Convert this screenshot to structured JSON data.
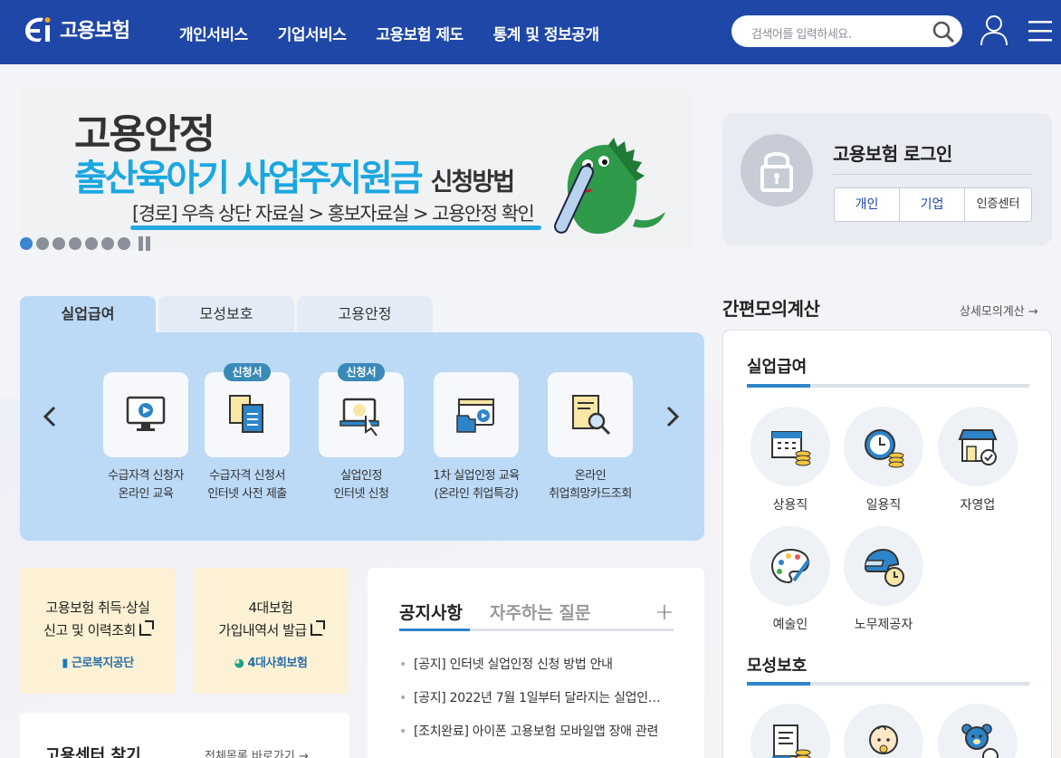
{
  "header": {
    "logo_text": "고용보험",
    "nav": [
      "개인서비스",
      "기업서비스",
      "고용보험 제도",
      "통계 및 정보공개"
    ],
    "search_placeholder": "검색어를 입력하세요."
  },
  "banner": {
    "line1": "고용안정",
    "line2_main": "출산육아기 사업주지원금",
    "line2_sub": "신청방법",
    "line3": "[경로] 우측 상단 자료실 > 홍보자료실 > 고용안정 확인",
    "slide_count": 7,
    "active_slide": 1
  },
  "login": {
    "title": "고용보험 로그인",
    "buttons": [
      "개인",
      "기업",
      "인증센터"
    ]
  },
  "service_tabs": {
    "tabs": [
      "실업급여",
      "모성보호",
      "고용안정"
    ],
    "active": 0,
    "items": [
      {
        "line1": "수급자격 신청자",
        "line2": "온라인 교육",
        "badge": "",
        "icon": "monitor-play-icon"
      },
      {
        "line1": "수급자격 신청서",
        "line2": "인터넷 사전 제출",
        "badge": "신청서",
        "icon": "documents-icon"
      },
      {
        "line1": "실업인정",
        "line2": "인터넷 신청",
        "badge": "신청서",
        "icon": "laptop-click-icon"
      },
      {
        "line1": "1차 실업인정 교육",
        "line2": "(온라인 취업특강)",
        "badge": "",
        "icon": "video-folder-icon"
      },
      {
        "line1": "온라인",
        "line2": "취업희망카드조회",
        "badge": "",
        "icon": "document-search-icon"
      }
    ]
  },
  "quick_cards": [
    {
      "line1": "고용보험 취득·상실",
      "line2": "신고 및 이력조회",
      "org": "근로복지공단"
    },
    {
      "line1": "4대보험",
      "line2": "가입내역서 발급",
      "org": "4대사회보험"
    }
  ],
  "center": {
    "title": "고용센터 찾기",
    "link": "전체목록 바로가기"
  },
  "notice": {
    "tab_active": "공지사항",
    "tab_other": "자주하는 질문",
    "more": "+",
    "items": [
      "[공지] 인터넷 실업인정 신청 방법 안내",
      "[공지] 2022년 7월 1일부터 달라지는 실업인…",
      "[조치완료] 아이폰 고용보험 모바일앱 장애 관련"
    ]
  },
  "calculator": {
    "title": "간편모의계산",
    "link": "상세모의계산",
    "section1": "실업급여",
    "items1": [
      {
        "label": "상용직",
        "icon": "calendar-coins-icon"
      },
      {
        "label": "일용직",
        "icon": "clock-coins-icon"
      },
      {
        "label": "자영업",
        "icon": "store-icon"
      },
      {
        "label": "예술인",
        "icon": "palette-icon"
      },
      {
        "label": "노무제공자",
        "icon": "helmet-clock-icon"
      }
    ],
    "section2": "모성보호",
    "items2": [
      {
        "label": "",
        "icon": "document-coins-icon"
      },
      {
        "label": "",
        "icon": "baby-icon"
      },
      {
        "label": "",
        "icon": "teddy-bear-icon"
      }
    ]
  }
}
